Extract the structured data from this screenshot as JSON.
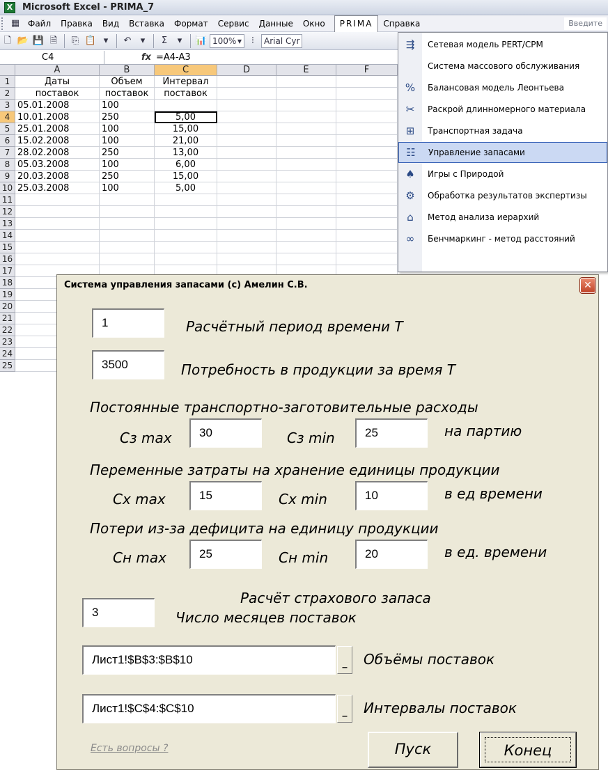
{
  "window": {
    "title": "Microsoft Excel - PRIMA_7"
  },
  "menu": {
    "items": [
      "Файл",
      "Правка",
      "Вид",
      "Вставка",
      "Формат",
      "Сервис",
      "Данные",
      "Окно",
      "PRIMA",
      "Справка"
    ],
    "help_box": "Введите"
  },
  "toolbar": {
    "zoom": "100%",
    "font": "Arial Cyr"
  },
  "formula_bar": {
    "name_box": "C4",
    "fx": "fx",
    "formula": "=A4-A3"
  },
  "sheet": {
    "columns": [
      "A",
      "B",
      "C",
      "D",
      "E",
      "F"
    ],
    "rows": [
      "1",
      "2",
      "3",
      "4",
      "5",
      "6",
      "7",
      "8",
      "9",
      "10",
      "11",
      "12",
      "13",
      "14",
      "15",
      "16",
      "17",
      "18",
      "19",
      "20",
      "21",
      "22",
      "23",
      "24",
      "25"
    ],
    "header1": [
      "Даты",
      "Объем",
      "Интервал"
    ],
    "header2": [
      "поставок",
      "поставок",
      "поставок"
    ],
    "data": [
      [
        "05.01.2008",
        "100",
        ""
      ],
      [
        "10.01.2008",
        "250",
        "5,00"
      ],
      [
        "25.01.2008",
        "100",
        "15,00"
      ],
      [
        "15.02.2008",
        "100",
        "21,00"
      ],
      [
        "28.02.2008",
        "250",
        "13,00"
      ],
      [
        "05.03.2008",
        "100",
        "6,00"
      ],
      [
        "20.03.2008",
        "250",
        "15,00"
      ],
      [
        "25.03.2008",
        "100",
        "5,00"
      ]
    ]
  },
  "prima_menu": [
    {
      "label": "Сетевая модель PERT/CPM",
      "icon": "network-icon"
    },
    {
      "label": "Система массового обслуживания",
      "icon": ""
    },
    {
      "label": "Балансовая модель Леонтьева",
      "icon": "balance-icon"
    },
    {
      "label": "Раскрой длинномерного материала",
      "icon": "scissors-icon"
    },
    {
      "label": "Транспортная задача",
      "icon": "transport-icon"
    },
    {
      "label": "Управление запасами",
      "icon": "inventory-icon"
    },
    {
      "label": "Игры с Природой",
      "icon": "spade-icon"
    },
    {
      "label": "Обработка результатов экспертизы",
      "icon": "expert-icon"
    },
    {
      "label": "Метод анализа иерархий",
      "icon": "hierarchy-icon"
    },
    {
      "label": "Бенчмаркинг - метод расстояний",
      "icon": "benchmark-icon"
    }
  ],
  "dialog": {
    "title": "Система управления запасами (c) Амелин С.В.",
    "close": "✕",
    "period_value": "1",
    "period_label": "Расчётный период времени Т",
    "demand_value": "3500",
    "demand_label": "Потребность в продукции за время Т",
    "fixed_costs_label": "Постоянные транспортно-заготовительные расходы",
    "cz_max_label": "Сз max",
    "cz_max_value": "30",
    "cz_min_label": "Сз min",
    "cz_min_value": "25",
    "per_batch_label": "на партию",
    "holding_label": "Переменные затраты на хранение единицы продукции",
    "cx_max_label": "Сх max",
    "cx_max_value": "15",
    "cx_min_label": "Сх min",
    "cx_min_value": "10",
    "per_time_label": "в ед времени",
    "shortage_label": "Потери из-за дефицита на единицу продукции",
    "cn_max_label": "Сн max",
    "cn_max_value": "25",
    "cn_min_label": "Сн min",
    "cn_min_value": "20",
    "per_time2_label": "в ед. времени",
    "safety_stock_label": "Расчёт страхового запаса",
    "months_value": "3",
    "months_label": "Число месяцев поставок",
    "volumes_ref": "Лист1!$B$3:$B$10",
    "volumes_label": "Объёмы поставок",
    "intervals_ref": "Лист1!$C$4:$C$10",
    "intervals_label": "Интервалы поставок",
    "ref_button": "_",
    "help_link": "Есть вопросы ?",
    "start_button": "Пуск",
    "end_button": "Конец"
  }
}
